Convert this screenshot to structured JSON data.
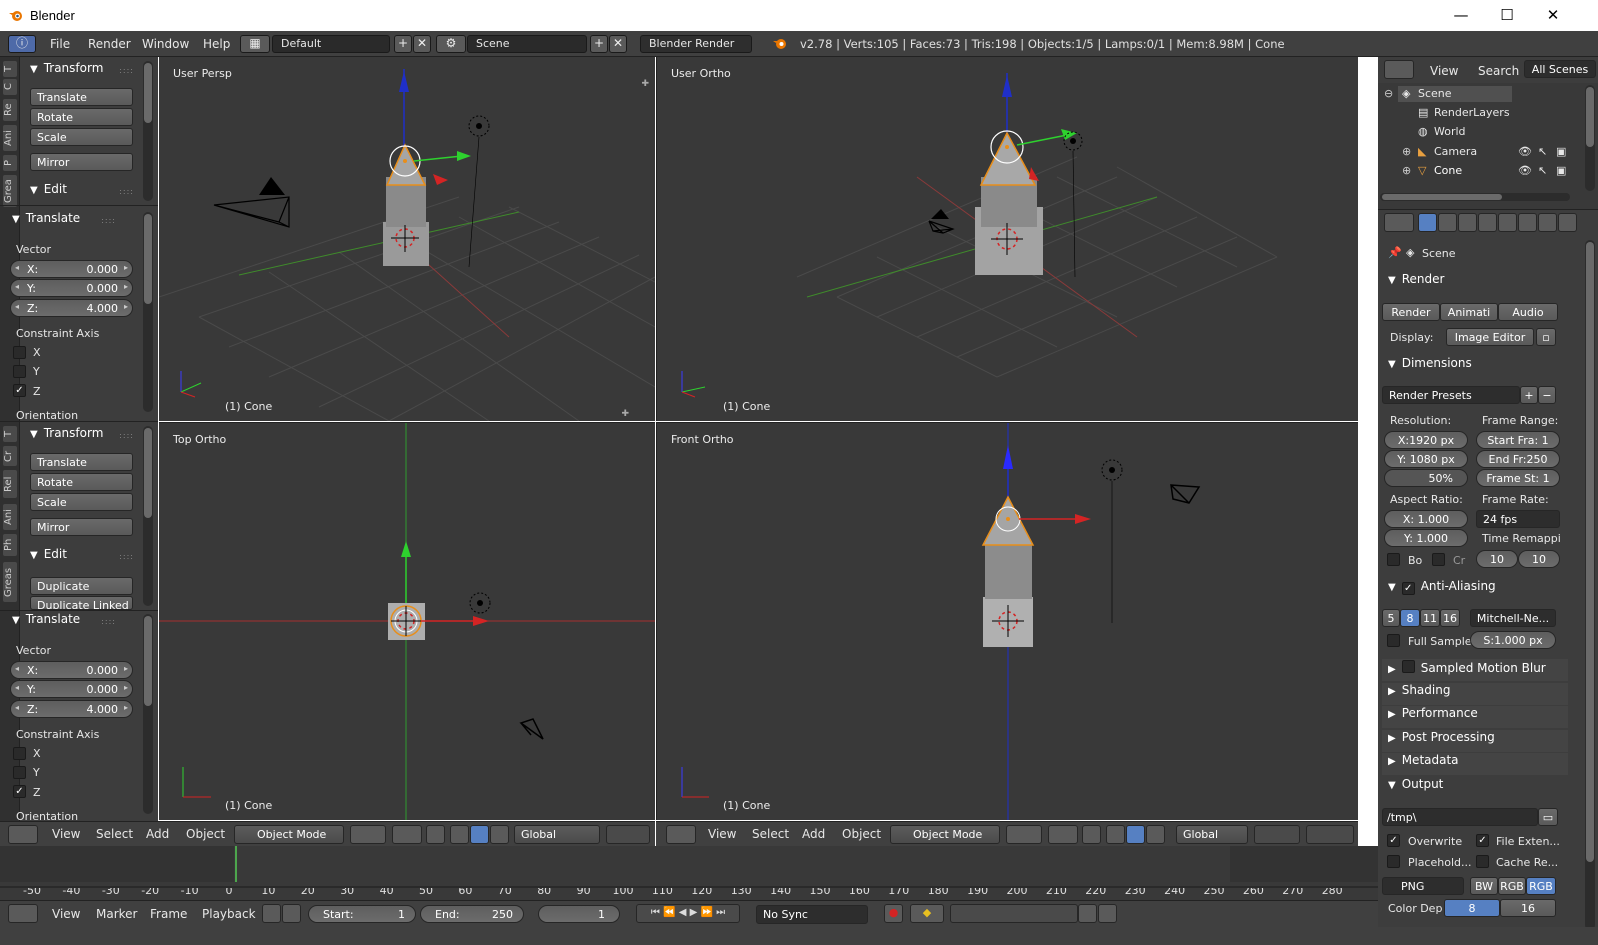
{
  "window": {
    "title": "Blender"
  },
  "info": {
    "menus": [
      "File",
      "Render",
      "Window",
      "Help"
    ],
    "layout": "Default",
    "scene": "Scene",
    "engine": "Blender Render",
    "stats": "v2.78 | Verts:105 | Faces:73 | Tris:198 | Objects:1/5 | Lamps:0/1 | Mem:8.98M | Cone"
  },
  "toolshelf": {
    "tabs_top": [
      "T",
      "C",
      "Re",
      "Ani",
      "P",
      "Grea"
    ],
    "tabs_bottom": [
      "T",
      "Cr",
      "Rel",
      "Ani",
      "Ph",
      "Greas"
    ],
    "transform_title": "Transform",
    "buttons": [
      "Translate",
      "Rotate",
      "Scale",
      "Mirror"
    ],
    "edit_title": "Edit",
    "edit_buttons": [
      "Duplicate",
      "Duplicate Linked"
    ],
    "op_title": "Translate",
    "vector_label": "Vector",
    "vector": [
      {
        "label": "X:",
        "value": "0.000"
      },
      {
        "label": "Y:",
        "value": "0.000"
      },
      {
        "label": "Z:",
        "value": "4.000"
      }
    ],
    "constraint_label": "Constraint Axis",
    "constraints": [
      {
        "label": "X",
        "checked": false
      },
      {
        "label": "Y",
        "checked": false
      },
      {
        "label": "Z",
        "checked": true
      }
    ],
    "orientation_label": "Orientation"
  },
  "viewports": [
    {
      "label": "User Persp",
      "object": "(1) Cone"
    },
    {
      "label": "User Ortho",
      "object": "(1) Cone"
    },
    {
      "label": "Top Ortho",
      "object": "(1) Cone"
    },
    {
      "label": "Front Ortho",
      "object": "(1) Cone"
    }
  ],
  "view3d_header": {
    "menus": [
      "View",
      "Select",
      "Add",
      "Object"
    ],
    "mode": "Object Mode",
    "orientation": "Global"
  },
  "outliner": {
    "menus": [
      "View",
      "Search"
    ],
    "filter": "All Scenes",
    "items": [
      "Scene",
      "RenderLayers",
      "World",
      "Camera",
      "Cone"
    ]
  },
  "properties": {
    "context": "Scene",
    "render_title": "Render",
    "render_buttons": [
      "Render",
      "Animati",
      "Audio"
    ],
    "display_label": "Display:",
    "display_value": "Image Editor",
    "dimensions_title": "Dimensions",
    "presets": "Render Presets",
    "resolution_label": "Resolution:",
    "frame_range_label": "Frame Range:",
    "res_x": "X:1920 px",
    "res_y": "Y: 1080 px",
    "res_pct": "50%",
    "start_frame": "Start Fra: 1",
    "end_frame": "End Fr:250",
    "frame_step": "Frame St: 1",
    "aspect_label": "Aspect Ratio:",
    "frame_rate_label": "Frame Rate:",
    "aspect_x": "X:    1.000",
    "aspect_y": "Y:    1.000",
    "fps": "24 fps",
    "time_remap_label": "Time Remappi",
    "bo_label": "Bo",
    "cr_label": "Cr",
    "remap_old": "10",
    "remap_new": "10",
    "aa_title": "Anti-Aliasing",
    "aa_samples": [
      "5",
      "8",
      "11",
      "16"
    ],
    "aa_filter": "Mitchell-Ne...",
    "full_sample": "Full Sample",
    "filter_size": "S:1.000 px",
    "sections": [
      "Sampled Motion Blur",
      "Shading",
      "Performance",
      "Post Processing",
      "Metadata"
    ],
    "output_title": "Output",
    "output_path": "/tmp\\",
    "overwrite": "Overwrite",
    "file_ext": "File Exten...",
    "placeholders": "Placehold...",
    "cache_result": "Cache Re...",
    "format": "PNG",
    "color_modes": [
      "BW",
      "RGB",
      "RGB"
    ],
    "color_depth_label": "Color Dep",
    "color_depths": [
      "8",
      "16"
    ]
  },
  "timeline": {
    "ticks": [
      "-50",
      "-40",
      "-30",
      "-20",
      "-10",
      "0",
      "10",
      "20",
      "30",
      "40",
      "50",
      "60",
      "70",
      "80",
      "90",
      "100",
      "110",
      "120",
      "130",
      "140",
      "150",
      "160",
      "170",
      "180",
      "190",
      "200",
      "210",
      "220",
      "230",
      "240",
      "250",
      "260",
      "270",
      "280"
    ],
    "menus": [
      "View",
      "Marker",
      "Frame",
      "Playback"
    ],
    "start": "Start:",
    "start_value": "1",
    "end": "End:",
    "end_value": "250",
    "current": "1",
    "sync": "No Sync"
  }
}
